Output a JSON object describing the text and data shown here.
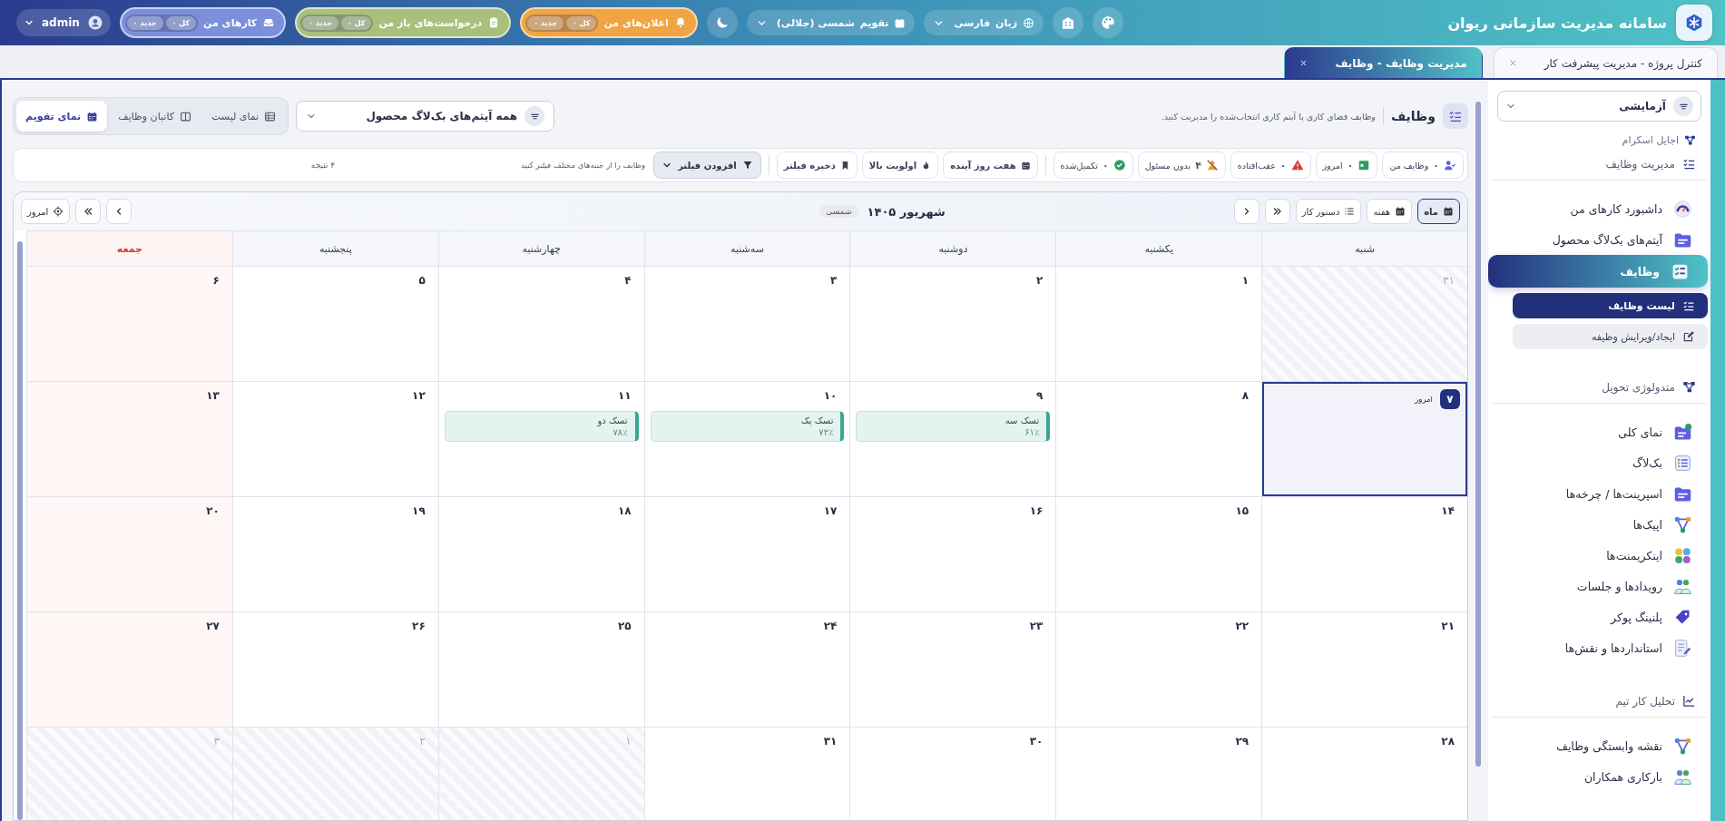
{
  "header": {
    "title": "سامانه مدیریت سازمانی ریوان",
    "language": {
      "label": "زبان",
      "value": "فارسی"
    },
    "calendar": {
      "label": "تقویم",
      "value": "شمسی (جلالی)"
    },
    "pills": [
      {
        "kind": "notifications",
        "label": "اعلان‌های من",
        "color": "#f0a444",
        "badges": [
          "کل ۰",
          "جدید ۰"
        ]
      },
      {
        "kind": "requests",
        "label": "درخواست‌های باز من",
        "color": "#a8c07c",
        "badges": [
          "کل ۰",
          "جدید ۰"
        ]
      },
      {
        "kind": "tasks",
        "label": "کارهای من",
        "color": "#7b8fdb",
        "badges": [
          "کل ۰",
          "جدید ۰"
        ]
      }
    ],
    "user": "admin"
  },
  "tabs": [
    {
      "label": "کنترل پروژه  -  مدیریت پیشرفت کار",
      "selected": false
    },
    {
      "label": "مدیریت وظایف  -  وظایف",
      "selected": true
    }
  ],
  "sidebar": {
    "workspace": "آزمایشی",
    "items": [
      {
        "kind": "category",
        "label": "اجایل اسکرام",
        "selected": false
      },
      {
        "kind": "section",
        "label": "مدیریت وظایف",
        "selected": false
      },
      {
        "kind": "link",
        "label": "داشبورد کارهای من",
        "selected": false
      },
      {
        "kind": "link",
        "label": "آیتم‌های بک‌لاگ محصول",
        "selected": false
      },
      {
        "kind": "link",
        "label": "وظایف",
        "selected": true,
        "children": [
          {
            "label": "لیست وظایف",
            "selected": true
          },
          {
            "label": "ایجاد/ویرایش وظیفه",
            "selected": false
          }
        ]
      },
      {
        "kind": "section",
        "label": "متدولوژی تحویل",
        "selected": false
      },
      {
        "kind": "link",
        "label": "نمای کلی",
        "selected": false
      },
      {
        "kind": "link",
        "label": "بک‌لاگ",
        "selected": false
      },
      {
        "kind": "link",
        "label": "اسپرینت‌ها / چرخه‌ها",
        "selected": false
      },
      {
        "kind": "link",
        "label": "اپیک‌ها",
        "selected": false
      },
      {
        "kind": "link",
        "label": "اینکریمنت‌ها",
        "selected": false
      },
      {
        "kind": "link",
        "label": "رویدادها و جلسات",
        "selected": false
      },
      {
        "kind": "link",
        "label": "پلنینگ پوکر",
        "selected": false
      },
      {
        "kind": "link",
        "label": "استانداردها و نقش‌ها",
        "selected": false
      },
      {
        "kind": "section",
        "label": "تحلیل کار تیم",
        "selected": false
      },
      {
        "kind": "link",
        "label": "نقشه وابستگی وظایف",
        "selected": false
      },
      {
        "kind": "link",
        "label": "بارکاری همکاران",
        "selected": false
      }
    ]
  },
  "page_header": {
    "title": "وظایف",
    "subtitle": "وظایف فضای کاری یا آیتم کاری انتخاب‌شده را مدیریت کنید.",
    "scope": "همه آیتم‌های بک‌لاگ محصول",
    "views": [
      {
        "label": "نمای لیست",
        "selected": false
      },
      {
        "label": "کانبان وظایف",
        "selected": false
      },
      {
        "label": "نمای تقویم",
        "selected": true
      }
    ]
  },
  "filters": {
    "quick": [
      {
        "label": "وظایف من",
        "count": "۰"
      },
      {
        "label": "امروز",
        "count": "۰"
      },
      {
        "label": "عقب‌افتاده",
        "count": "۰"
      },
      {
        "label": "بدون مسئول",
        "count": "۴"
      },
      {
        "label": "تکمیل‌شده",
        "count": "۰"
      }
    ],
    "presets": [
      "هفت روز آینده",
      "اولویت بالا",
      "ذخیره فیلتر"
    ],
    "add_filter": "افزودن فیلتر",
    "hint": "وظایف را از جنبه‌های مختلف فیلتر کنید",
    "results": "۴ نتیجه"
  },
  "calendar": {
    "views": [
      {
        "label": "ماه",
        "selected": true
      },
      {
        "label": "هفته",
        "selected": false
      },
      {
        "label": "دستور کار",
        "selected": false
      }
    ],
    "title": "شهریور ۱۴۰۵",
    "system": "شمسی",
    "today_button": "امروز",
    "weekdays": [
      {
        "label": "شنبه",
        "holiday": false
      },
      {
        "label": "یکشنبه",
        "holiday": false
      },
      {
        "label": "دوشنبه",
        "holiday": false
      },
      {
        "label": "سه‌شنبه",
        "holiday": false
      },
      {
        "label": "چهارشنبه",
        "holiday": false
      },
      {
        "label": "پنجشنبه",
        "holiday": false
      },
      {
        "label": "جمعه",
        "holiday": true
      }
    ],
    "weeks": [
      [
        {
          "day": "۳۱",
          "outside": true,
          "today": false
        },
        {
          "day": "۱",
          "outside": false,
          "today": false
        },
        {
          "day": "۲",
          "outside": false,
          "today": false
        },
        {
          "day": "۳",
          "outside": false,
          "today": false
        },
        {
          "day": "۴",
          "outside": false,
          "today": false
        },
        {
          "day": "۵",
          "outside": false,
          "today": false
        },
        {
          "day": "۶",
          "outside": false,
          "today": false
        }
      ],
      [
        {
          "day": "۷",
          "outside": false,
          "today": true,
          "today_label": "امروز"
        },
        {
          "day": "۸",
          "outside": false,
          "today": false
        },
        {
          "day": "۹",
          "outside": false,
          "today": false,
          "tasks": [
            {
              "title": "تسک سه",
              "progress": "۶۱٪"
            }
          ]
        },
        {
          "day": "۱۰",
          "outside": false,
          "today": false,
          "tasks": [
            {
              "title": "تسک یک",
              "progress": "۷۲٪"
            }
          ]
        },
        {
          "day": "۱۱",
          "outside": false,
          "today": false,
          "tasks": [
            {
              "title": "تسک دو",
              "progress": "۷۸٪"
            }
          ]
        },
        {
          "day": "۱۲",
          "outside": false,
          "today": false
        },
        {
          "day": "۱۳",
          "outside": false,
          "today": false
        }
      ],
      [
        {
          "day": "۱۴",
          "outside": false,
          "today": false
        },
        {
          "day": "۱۵",
          "outside": false,
          "today": false
        },
        {
          "day": "۱۶",
          "outside": false,
          "today": false
        },
        {
          "day": "۱۷",
          "outside": false,
          "today": false
        },
        {
          "day": "۱۸",
          "outside": false,
          "today": false
        },
        {
          "day": "۱۹",
          "outside": false,
          "today": false
        },
        {
          "day": "۲۰",
          "outside": false,
          "today": false
        }
      ],
      [
        {
          "day": "۲۱",
          "outside": false,
          "today": false
        },
        {
          "day": "۲۲",
          "outside": false,
          "today": false
        },
        {
          "day": "۲۳",
          "outside": false,
          "today": false
        },
        {
          "day": "۲۴",
          "outside": false,
          "today": false
        },
        {
          "day": "۲۵",
          "outside": false,
          "today": false
        },
        {
          "day": "۲۶",
          "outside": false,
          "today": false
        },
        {
          "day": "۲۷",
          "outside": false,
          "today": false
        }
      ],
      [
        {
          "day": "۲۸",
          "outside": false,
          "today": false
        },
        {
          "day": "۲۹",
          "outside": false,
          "today": false
        },
        {
          "day": "۳۰",
          "outside": false,
          "today": false
        },
        {
          "day": "۳۱",
          "outside": false,
          "today": false
        },
        {
          "day": "۱",
          "outside": true,
          "today": false
        },
        {
          "day": "۲",
          "outside": true,
          "today": false
        },
        {
          "day": "۳",
          "outside": true,
          "today": false
        }
      ]
    ]
  }
}
